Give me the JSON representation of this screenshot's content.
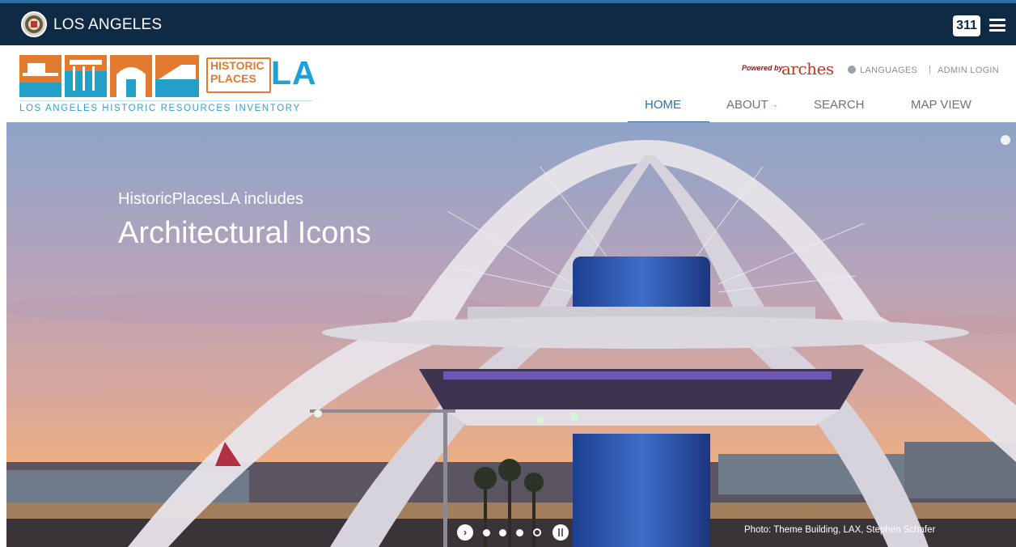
{
  "citybar": {
    "city_name": "LOS ANGELES",
    "badge": "311",
    "colors": {
      "background": "#0f2a45",
      "accent": "#2a6fa8"
    },
    "icons": {
      "seal": "city-seal-icon",
      "menu": "hamburger-menu-icon"
    }
  },
  "header": {
    "logo": {
      "historic_line1": "HISTORIC",
      "historic_line2": "PLACES",
      "la": "LA",
      "tagline": "LOS ANGELES HISTORIC RESOURCES INVENTORY"
    },
    "utility": {
      "powered_by": "Powered by",
      "arches": "arches",
      "languages": "LANGUAGES",
      "separator": "|",
      "admin_login": "ADMIN LOGIN"
    },
    "nav": {
      "home": "HOME",
      "about": "ABOUT",
      "search": "SEARCH",
      "map_view": "MAP VIEW",
      "active": "HOME"
    }
  },
  "hero": {
    "kicker": "HistoricPlacesLA includes",
    "title": "Architectural Icons",
    "photo_credit": "Photo: Theme Building, LAX, Stephen Schafer",
    "slides_total": 4,
    "slide_current": 4
  }
}
